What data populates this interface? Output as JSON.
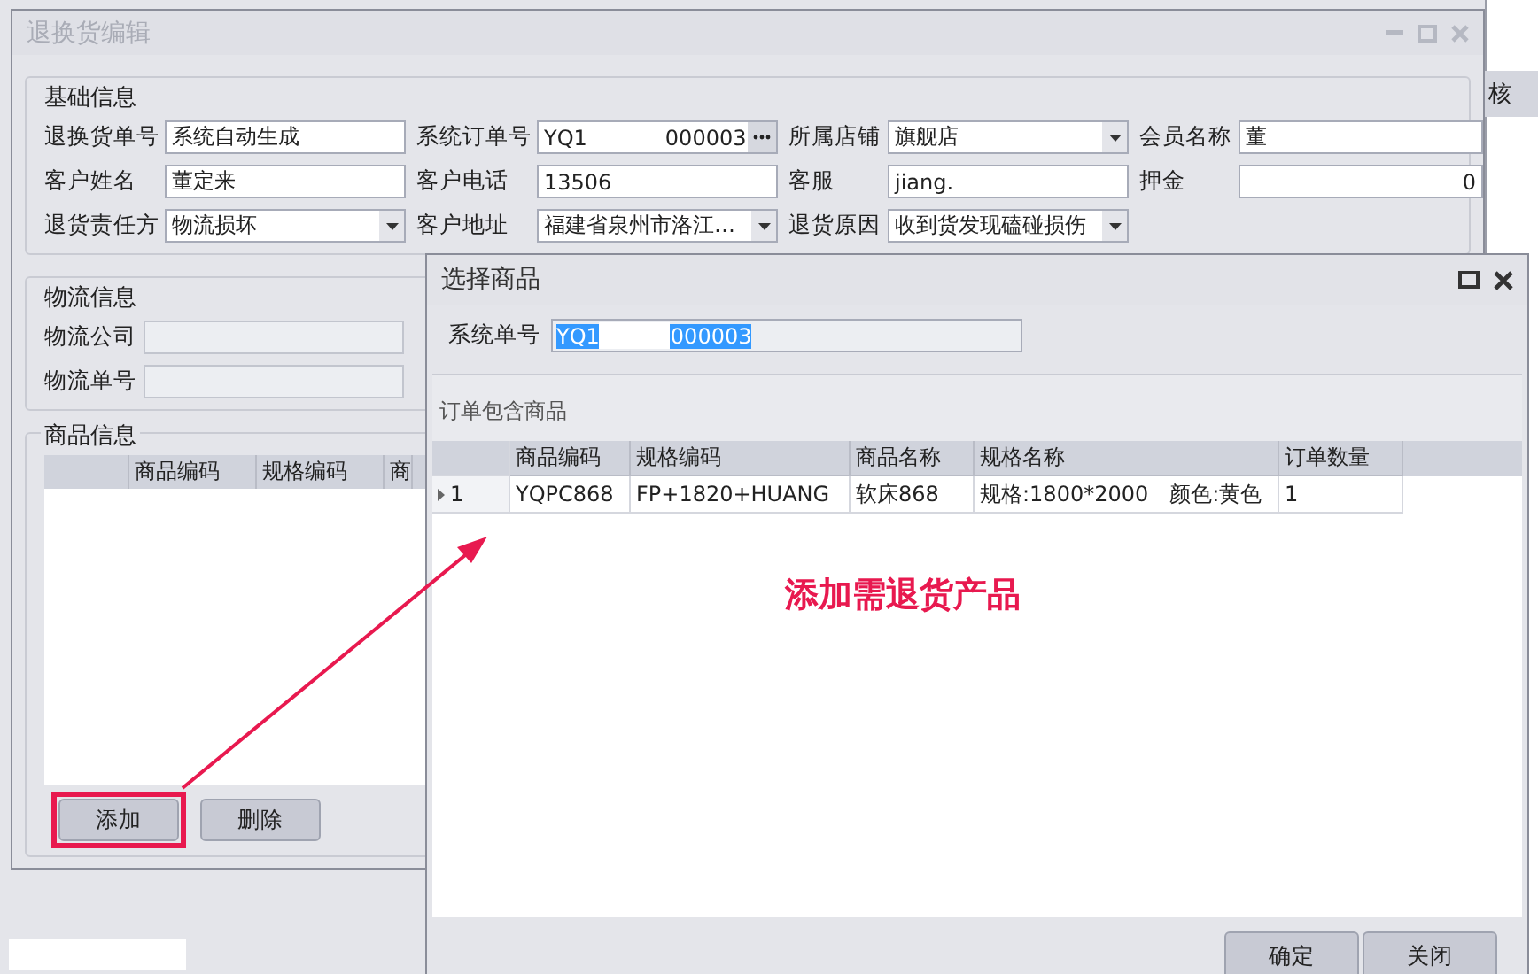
{
  "background": {
    "column_header": "核"
  },
  "main_window": {
    "title": "退换货编辑",
    "active": false,
    "basic_info": {
      "title": "基础信息",
      "fields": [
        {
          "label": "退换货单号",
          "kind": "text",
          "parts": [
            "系统自动生成"
          ]
        },
        {
          "label": "系统订单号",
          "kind": "lookup",
          "parts": [
            "YQ1",
            "000003"
          ]
        },
        {
          "label": "所属店铺",
          "kind": "combo",
          "parts": [
            "旗舰店"
          ]
        },
        {
          "label": "会员名称",
          "kind": "text",
          "parts": [
            "董"
          ]
        },
        {
          "label": "客户姓名",
          "kind": "text",
          "parts": [
            "董定来"
          ]
        },
        {
          "label": "客户电话",
          "kind": "text",
          "parts": [
            "13506"
          ]
        },
        {
          "label": "客服",
          "kind": "text",
          "parts": [
            "jiang."
          ]
        },
        {
          "label": "押金",
          "kind": "number",
          "parts": [
            "0"
          ]
        },
        {
          "label": "退货责任方",
          "kind": "combo",
          "parts": [
            "物流损坏"
          ]
        },
        {
          "label": "客户地址",
          "kind": "combo",
          "parts": [
            "福建省泉州市洛江…"
          ]
        },
        {
          "label": "退货原因",
          "kind": "combo",
          "parts": [
            "收到货发现磕碰损伤"
          ]
        }
      ]
    },
    "logistics": {
      "title": "物流信息",
      "fields": [
        {
          "label": "物流公司",
          "disabled": true
        },
        {
          "label": "物流单号",
          "disabled": true
        }
      ]
    },
    "goods": {
      "title": "商品信息",
      "columns": [
        "商品编码",
        "规格编码",
        "商"
      ],
      "buttons": [
        {
          "label": "添加",
          "highlighted": true
        },
        {
          "label": "删除",
          "highlighted": false
        }
      ]
    }
  },
  "dialog": {
    "title": "选择商品",
    "order_field": {
      "label": "系统单号",
      "parts": [
        "YQ1",
        "000003"
      ],
      "selected": true
    },
    "panel_title": "订单包含商品",
    "columns": [
      "商品编码",
      "规格编码",
      "商品名称",
      "规格名称",
      "订单数量"
    ],
    "rows": [
      {
        "current": true,
        "number": "1",
        "cells": [
          "YQPC868",
          "FP+1820+HUANG",
          "软床868",
          "规格:1800*2000　颜色:黄色",
          "1"
        ]
      }
    ],
    "buttons": [
      "确定",
      "关闭"
    ]
  },
  "annotation": {
    "text": "添加需退货产品"
  }
}
